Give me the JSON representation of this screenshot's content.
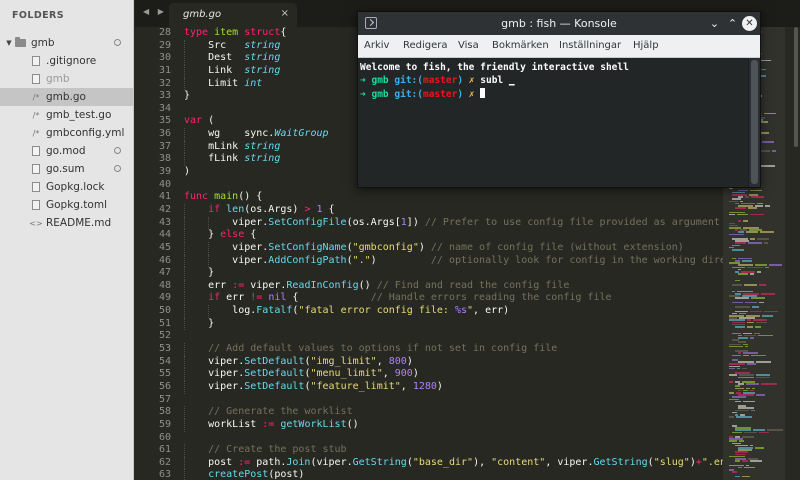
{
  "sidebar": {
    "header": "FOLDERS",
    "root_folder": "gmb",
    "files": [
      {
        "name": ".gitignore",
        "icon": "file-icon",
        "selected": false,
        "dim": false,
        "dot": false
      },
      {
        "name": "gmb",
        "icon": "file-icon",
        "selected": false,
        "dim": true,
        "dot": false
      },
      {
        "name": "gmb.go",
        "icon": "code-file-icon",
        "selected": true,
        "dim": false,
        "dot": false
      },
      {
        "name": "gmb_test.go",
        "icon": "code-file-icon",
        "selected": false,
        "dim": false,
        "dot": false
      },
      {
        "name": "gmbconfig.yml",
        "icon": "code-file-icon",
        "selected": false,
        "dim": false,
        "dot": false
      },
      {
        "name": "go.mod",
        "icon": "file-icon",
        "selected": false,
        "dim": false,
        "dot": true
      },
      {
        "name": "go.sum",
        "icon": "file-icon",
        "selected": false,
        "dim": false,
        "dot": true
      },
      {
        "name": "Gopkg.lock",
        "icon": "file-icon",
        "selected": false,
        "dim": false,
        "dot": false
      },
      {
        "name": "Gopkg.toml",
        "icon": "file-icon",
        "selected": false,
        "dim": false,
        "dot": false
      },
      {
        "name": "README.md",
        "icon": "markup-file-icon",
        "selected": false,
        "dim": false,
        "dot": false
      }
    ]
  },
  "editor": {
    "nav_arrows": "◀ ▶",
    "tab_title": "gmb.go",
    "tab_close": "×",
    "lines": [
      {
        "n": "28",
        "indent": 0,
        "t": [
          [
            "kw",
            "type "
          ],
          [
            "fn",
            "item "
          ],
          [
            "kw",
            "struct"
          ],
          [
            "",
            "{"
          ]
        ]
      },
      {
        "n": "29",
        "indent": 1,
        "t": [
          [
            "",
            "Src   "
          ],
          [
            "ty",
            "string"
          ]
        ]
      },
      {
        "n": "30",
        "indent": 1,
        "t": [
          [
            "",
            "Dest  "
          ],
          [
            "ty",
            "string"
          ]
        ]
      },
      {
        "n": "31",
        "indent": 1,
        "t": [
          [
            "",
            "Link  "
          ],
          [
            "ty",
            "string"
          ]
        ]
      },
      {
        "n": "32",
        "indent": 1,
        "t": [
          [
            "",
            "Limit "
          ],
          [
            "ty",
            "int"
          ]
        ]
      },
      {
        "n": "33",
        "indent": 0,
        "t": [
          [
            "",
            "}"
          ]
        ]
      },
      {
        "n": "34",
        "indent": 0,
        "t": []
      },
      {
        "n": "35",
        "indent": 0,
        "t": [
          [
            "kw",
            "var"
          ],
          [
            "",
            " ("
          ]
        ]
      },
      {
        "n": "36",
        "indent": 1,
        "t": [
          [
            "",
            "wg    sync."
          ],
          [
            "ty",
            "WaitGroup"
          ]
        ]
      },
      {
        "n": "37",
        "indent": 1,
        "t": [
          [
            "",
            "mLink "
          ],
          [
            "ty",
            "string"
          ]
        ]
      },
      {
        "n": "38",
        "indent": 1,
        "t": [
          [
            "",
            "fLink "
          ],
          [
            "ty",
            "string"
          ]
        ]
      },
      {
        "n": "39",
        "indent": 0,
        "t": [
          [
            "",
            ")"
          ]
        ]
      },
      {
        "n": "40",
        "indent": 0,
        "t": []
      },
      {
        "n": "41",
        "indent": 0,
        "t": [
          [
            "kw",
            "func "
          ],
          [
            "fn",
            "main"
          ],
          [
            "",
            "() {"
          ]
        ]
      },
      {
        "n": "42",
        "indent": 1,
        "t": [
          [
            "kw",
            "if "
          ],
          [
            "mt",
            "len"
          ],
          [
            "",
            "(os.Args) "
          ],
          [
            "kw",
            ">"
          ],
          [
            "",
            " "
          ],
          [
            "nu",
            "1"
          ],
          [
            "",
            " {"
          ]
        ]
      },
      {
        "n": "43",
        "indent": 2,
        "t": [
          [
            "",
            "viper."
          ],
          [
            "mt",
            "SetConfigFile"
          ],
          [
            "",
            "(os.Args["
          ],
          [
            "nu",
            "1"
          ],
          [
            "",
            "]) "
          ],
          [
            "cm",
            "// Prefer to use config file provided as argument"
          ]
        ]
      },
      {
        "n": "44",
        "indent": 1,
        "t": [
          [
            "",
            "} "
          ],
          [
            "kw",
            "else"
          ],
          [
            "",
            " {"
          ]
        ]
      },
      {
        "n": "45",
        "indent": 2,
        "t": [
          [
            "",
            "viper."
          ],
          [
            "mt",
            "SetConfigName"
          ],
          [
            "",
            "("
          ],
          [
            "st",
            "\"gmbconfig\""
          ],
          [
            "",
            ") "
          ],
          [
            "cm",
            "// name of config file (without extension)"
          ]
        ]
      },
      {
        "n": "46",
        "indent": 2,
        "t": [
          [
            "",
            "viper."
          ],
          [
            "mt",
            "AddConfigPath"
          ],
          [
            "",
            "("
          ],
          [
            "st",
            "\".\""
          ],
          [
            "",
            ")         "
          ],
          [
            "cm",
            "// optionally look for config in the working direc"
          ]
        ]
      },
      {
        "n": "47",
        "indent": 1,
        "t": [
          [
            "",
            "}"
          ]
        ]
      },
      {
        "n": "48",
        "indent": 1,
        "t": [
          [
            "",
            "err "
          ],
          [
            "kw",
            ":="
          ],
          [
            "",
            " viper."
          ],
          [
            "mt",
            "ReadInConfig"
          ],
          [
            "",
            "() "
          ],
          [
            "cm",
            "// Find and read the config file"
          ]
        ]
      },
      {
        "n": "49",
        "indent": 1,
        "t": [
          [
            "kw",
            "if "
          ],
          [
            "",
            "err "
          ],
          [
            "kw",
            "!="
          ],
          [
            "",
            " "
          ],
          [
            "nu",
            "nil"
          ],
          [
            "",
            " {            "
          ],
          [
            "cm",
            "// Handle errors reading the config file"
          ]
        ]
      },
      {
        "n": "50",
        "indent": 2,
        "t": [
          [
            "",
            "log."
          ],
          [
            "mt",
            "Fatalf"
          ],
          [
            "",
            "("
          ],
          [
            "st",
            "\"fatal error config file: "
          ],
          [
            "sf",
            "%s"
          ],
          [
            "st",
            "\""
          ],
          [
            "",
            ", err)"
          ]
        ]
      },
      {
        "n": "51",
        "indent": 1,
        "t": [
          [
            "",
            "}"
          ]
        ]
      },
      {
        "n": "52",
        "indent": 0,
        "t": []
      },
      {
        "n": "53",
        "indent": 1,
        "t": [
          [
            "cm",
            "// Add default values to options if not set in config file"
          ]
        ]
      },
      {
        "n": "54",
        "indent": 1,
        "t": [
          [
            "",
            "viper."
          ],
          [
            "mt",
            "SetDefault"
          ],
          [
            "",
            "("
          ],
          [
            "st",
            "\"img_limit\""
          ],
          [
            "",
            ", "
          ],
          [
            "nu",
            "800"
          ],
          [
            "",
            ")"
          ]
        ]
      },
      {
        "n": "55",
        "indent": 1,
        "t": [
          [
            "",
            "viper."
          ],
          [
            "mt",
            "SetDefault"
          ],
          [
            "",
            "("
          ],
          [
            "st",
            "\"menu_limit\""
          ],
          [
            "",
            ", "
          ],
          [
            "nu",
            "900"
          ],
          [
            "",
            ")"
          ]
        ]
      },
      {
        "n": "56",
        "indent": 1,
        "t": [
          [
            "",
            "viper."
          ],
          [
            "mt",
            "SetDefault"
          ],
          [
            "",
            "("
          ],
          [
            "st",
            "\"feature_limit\""
          ],
          [
            "",
            ", "
          ],
          [
            "nu",
            "1280"
          ],
          [
            "",
            ")"
          ]
        ]
      },
      {
        "n": "57",
        "indent": 0,
        "t": []
      },
      {
        "n": "58",
        "indent": 1,
        "t": [
          [
            "cm",
            "// Generate the worklist"
          ]
        ]
      },
      {
        "n": "59",
        "indent": 1,
        "t": [
          [
            "",
            "workList "
          ],
          [
            "kw",
            ":="
          ],
          [
            "",
            " "
          ],
          [
            "mt",
            "getWorkList"
          ],
          [
            "",
            "()"
          ]
        ]
      },
      {
        "n": "60",
        "indent": 0,
        "t": []
      },
      {
        "n": "61",
        "indent": 1,
        "t": [
          [
            "cm",
            "// Create the post stub"
          ]
        ]
      },
      {
        "n": "62",
        "indent": 1,
        "t": [
          [
            "",
            "post "
          ],
          [
            "kw",
            ":="
          ],
          [
            "",
            " path."
          ],
          [
            "mt",
            "Join"
          ],
          [
            "",
            "(viper."
          ],
          [
            "mt",
            "GetString"
          ],
          [
            "",
            "("
          ],
          [
            "st",
            "\"base_dir\""
          ],
          [
            "",
            "), "
          ],
          [
            "st",
            "\"content\""
          ],
          [
            "",
            ", viper."
          ],
          [
            "mt",
            "GetString"
          ],
          [
            "",
            "("
          ],
          [
            "st",
            "\"slug\""
          ],
          [
            "",
            ")"
          ],
          [
            "kw",
            "+"
          ],
          [
            "st",
            "\".en."
          ]
        ]
      },
      {
        "n": "63",
        "indent": 1,
        "t": [
          [
            "mt",
            "createPost"
          ],
          [
            "",
            "(post)"
          ]
        ]
      }
    ]
  },
  "konsole": {
    "title": "gmb : fish — Konsole",
    "buttons": {
      "minimize": "⌄",
      "maximize": "⌃",
      "close": "✕"
    },
    "menu": [
      "Arkiv",
      "Redigera",
      "Visa",
      "Bokmärken",
      "Inställningar",
      "Hjälp"
    ],
    "welcome": "Welcome to fish, the friendly interactive shell",
    "prompt": {
      "arrow": "➜",
      "dir": "gmb",
      "git": "git:(",
      "branch": "master",
      "git_close": ")",
      "x": "✗"
    },
    "command1": "subl",
    "command1_tail": "_",
    "command2": ""
  },
  "colors": {
    "editor_bg": "#272822",
    "sidebar_bg": "#e5e5e5",
    "konsole_bg": "#232627",
    "accent_green": "#1cdc9a",
    "accent_red": "#ed1515"
  }
}
